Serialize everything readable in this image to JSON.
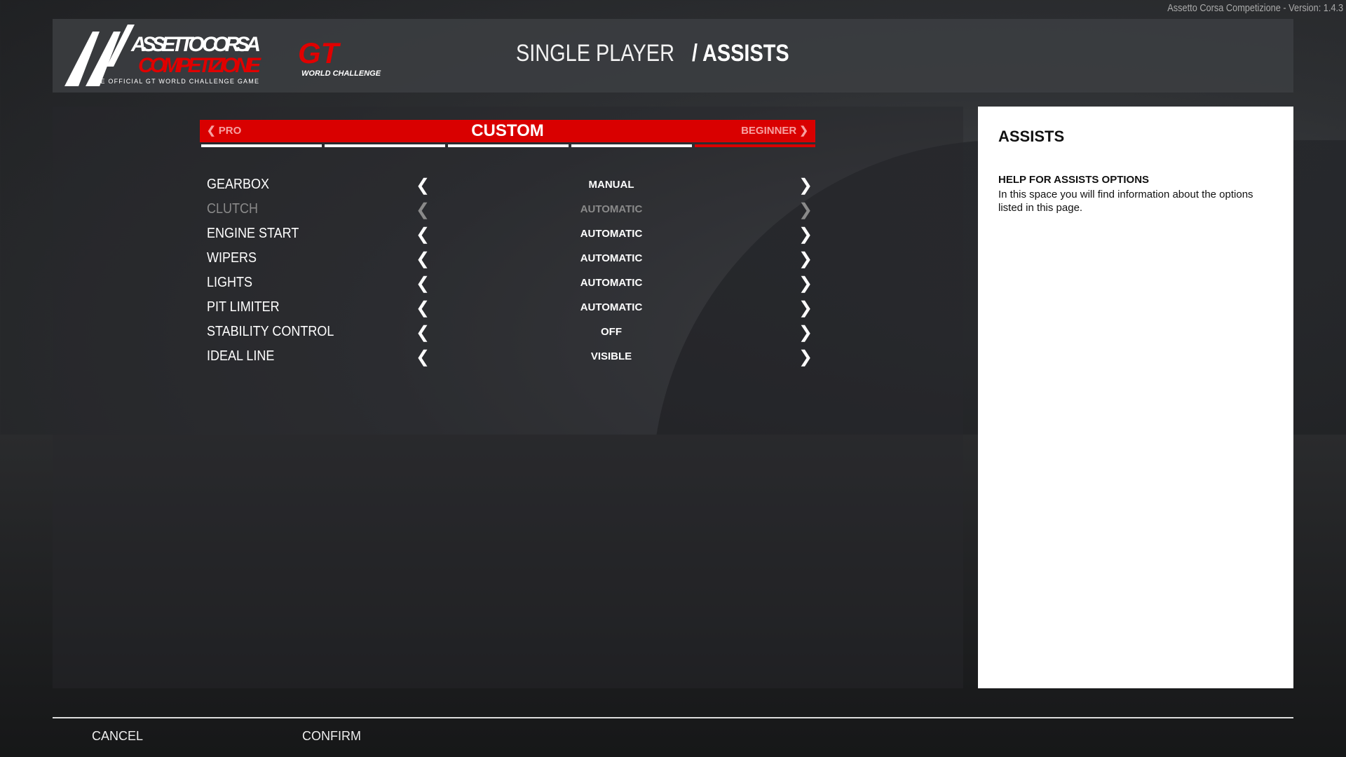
{
  "version_text": "Assetto Corsa Competizione - Version: 1.4.3",
  "header": {
    "logo_text": "ASSETTO CORSA COMPETIZIONE",
    "logo_tagline": "THE OFFICIAL GT WORLD CHALLENGE GAME",
    "gt_logo_text": "WORLD CHALLENGE",
    "title_prefix": "SINGLE PLAYER",
    "title_main": "/ ASSISTS"
  },
  "preset": {
    "prev": "PRO",
    "current": "CUSTOM",
    "next": "BEGINNER",
    "segments": 5,
    "active_segment": 5,
    "accent": "#d90000"
  },
  "options": [
    {
      "label": "GEARBOX",
      "value": "MANUAL",
      "enabled": true
    },
    {
      "label": "CLUTCH",
      "value": "AUTOMATIC",
      "enabled": false
    },
    {
      "label": "ENGINE START",
      "value": "AUTOMATIC",
      "enabled": true
    },
    {
      "label": "WIPERS",
      "value": "AUTOMATIC",
      "enabled": true
    },
    {
      "label": "LIGHTS",
      "value": "AUTOMATIC",
      "enabled": true
    },
    {
      "label": "PIT LIMITER",
      "value": "AUTOMATIC",
      "enabled": true
    },
    {
      "label": "STABILITY CONTROL",
      "value": "OFF",
      "enabled": true
    },
    {
      "label": "IDEAL LINE",
      "value": "VISIBLE",
      "enabled": true
    }
  ],
  "help": {
    "title": "ASSISTS",
    "subtitle": "HELP FOR ASSISTS OPTIONS",
    "text": "In this space you will find information about the options listed in this page."
  },
  "footer": {
    "cancel": "CANCEL",
    "confirm": "CONFIRM"
  }
}
